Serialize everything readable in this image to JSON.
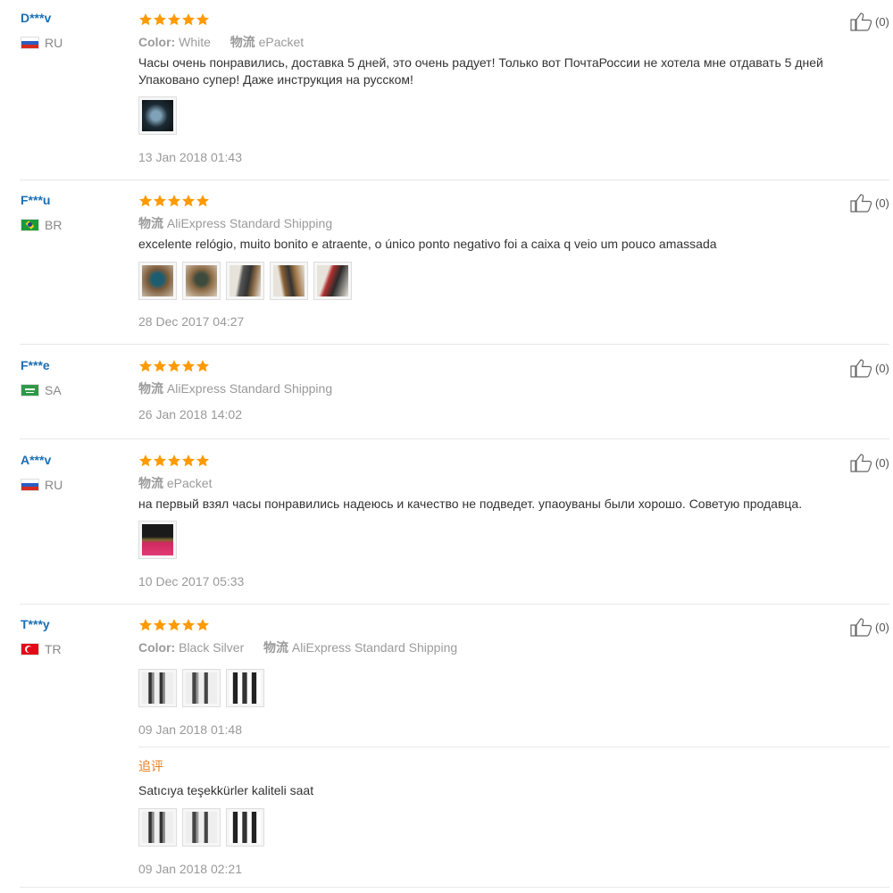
{
  "icons": {
    "star": "star-icon",
    "like": "thumbs-up-icon"
  },
  "colors": {
    "star": "#ff9a00",
    "username": "#1a6fb4",
    "followup": "#e67e22"
  },
  "reviews": [
    {
      "user": "D***v",
      "country": "RU",
      "rating": 5,
      "color_label": "Color:",
      "color_value": "White",
      "shipping_label": "物流",
      "shipping_value": "ePacket",
      "text": "Часы очень понравились, доставка 5 дней, это очень радует! Только вот ПочтаРоссии не хотела мне отдавать 5 дней Упаковано супер! Даже инструкция на русском!",
      "photos": 1,
      "date": "13 Jan 2018 01:43",
      "likes": "(0)"
    },
    {
      "user": "F***u",
      "country": "BR",
      "rating": 5,
      "shipping_label": "物流",
      "shipping_value": "AliExpress Standard Shipping",
      "text": "excelente relógio, muito bonito e atraente, o único ponto negativo foi a caixa q veio um pouco amassada",
      "photos": 5,
      "date": "28 Dec 2017 04:27",
      "likes": "(0)"
    },
    {
      "user": "F***e",
      "country": "SA",
      "rating": 5,
      "shipping_label": "物流",
      "shipping_value": "AliExpress Standard Shipping",
      "date": "26 Jan 2018 14:02",
      "likes": "(0)"
    },
    {
      "user": "A***v",
      "country": "RU",
      "rating": 5,
      "shipping_label": "物流",
      "shipping_value": "ePacket",
      "text": "на первый взял часы понравились надеюсь и качество не подведет. упаоуваны были хорошо. Советую продавца.",
      "photos": 1,
      "date": "10 Dec 2017 05:33",
      "likes": "(0)"
    },
    {
      "user": "T***y",
      "country": "TR",
      "rating": 5,
      "color_label": "Color:",
      "color_value": "Black Silver",
      "shipping_label": "物流",
      "shipping_value": "AliExpress Standard Shipping",
      "photos": 3,
      "date": "09 Jan 2018 01:48",
      "likes": "(0)",
      "followup": {
        "label": "追评",
        "text": "Satıcıya teşekkürler kaliteli saat",
        "photos": 3,
        "date": "09 Jan 2018 02:21"
      }
    }
  ]
}
